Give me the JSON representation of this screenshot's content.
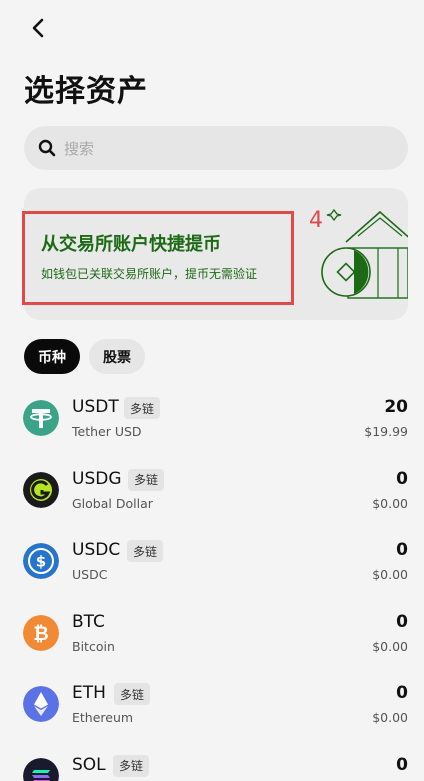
{
  "header": {
    "back_icon": "chevron-left-icon",
    "title": "选择资产"
  },
  "search": {
    "placeholder": "搜索"
  },
  "banner": {
    "title": "从交易所账户快捷提币",
    "subtitle": "如钱包已关联交易所账户，提币无需验证",
    "annotation": "4"
  },
  "tabs": [
    {
      "label": "币种",
      "active": true
    },
    {
      "label": "股票",
      "active": false
    }
  ],
  "assets": [
    {
      "symbol": "USDT",
      "badge": "多链",
      "name": "Tether USD",
      "amount": "20",
      "value": "$19.99",
      "icon": "tether-icon",
      "color": "#3aa388"
    },
    {
      "symbol": "USDG",
      "badge": "多链",
      "name": "Global Dollar",
      "amount": "0",
      "value": "$0.00",
      "icon": "usdg-icon",
      "color": "#1a1a1a"
    },
    {
      "symbol": "USDC",
      "badge": "多链",
      "name": "USDC",
      "amount": "0",
      "value": "$0.00",
      "icon": "usdc-icon",
      "color": "#2775ca"
    },
    {
      "symbol": "BTC",
      "badge": "",
      "name": "Bitcoin",
      "amount": "0",
      "value": "$0.00",
      "icon": "bitcoin-icon",
      "color": "#f08a35"
    },
    {
      "symbol": "ETH",
      "badge": "多链",
      "name": "Ethereum",
      "amount": "0",
      "value": "$0.00",
      "icon": "ethereum-icon",
      "color": "#5a72e6"
    },
    {
      "symbol": "SOL",
      "badge": "多链",
      "name": "",
      "amount": "0",
      "value": "",
      "icon": "solana-icon",
      "color": "#1a1a2e"
    }
  ]
}
